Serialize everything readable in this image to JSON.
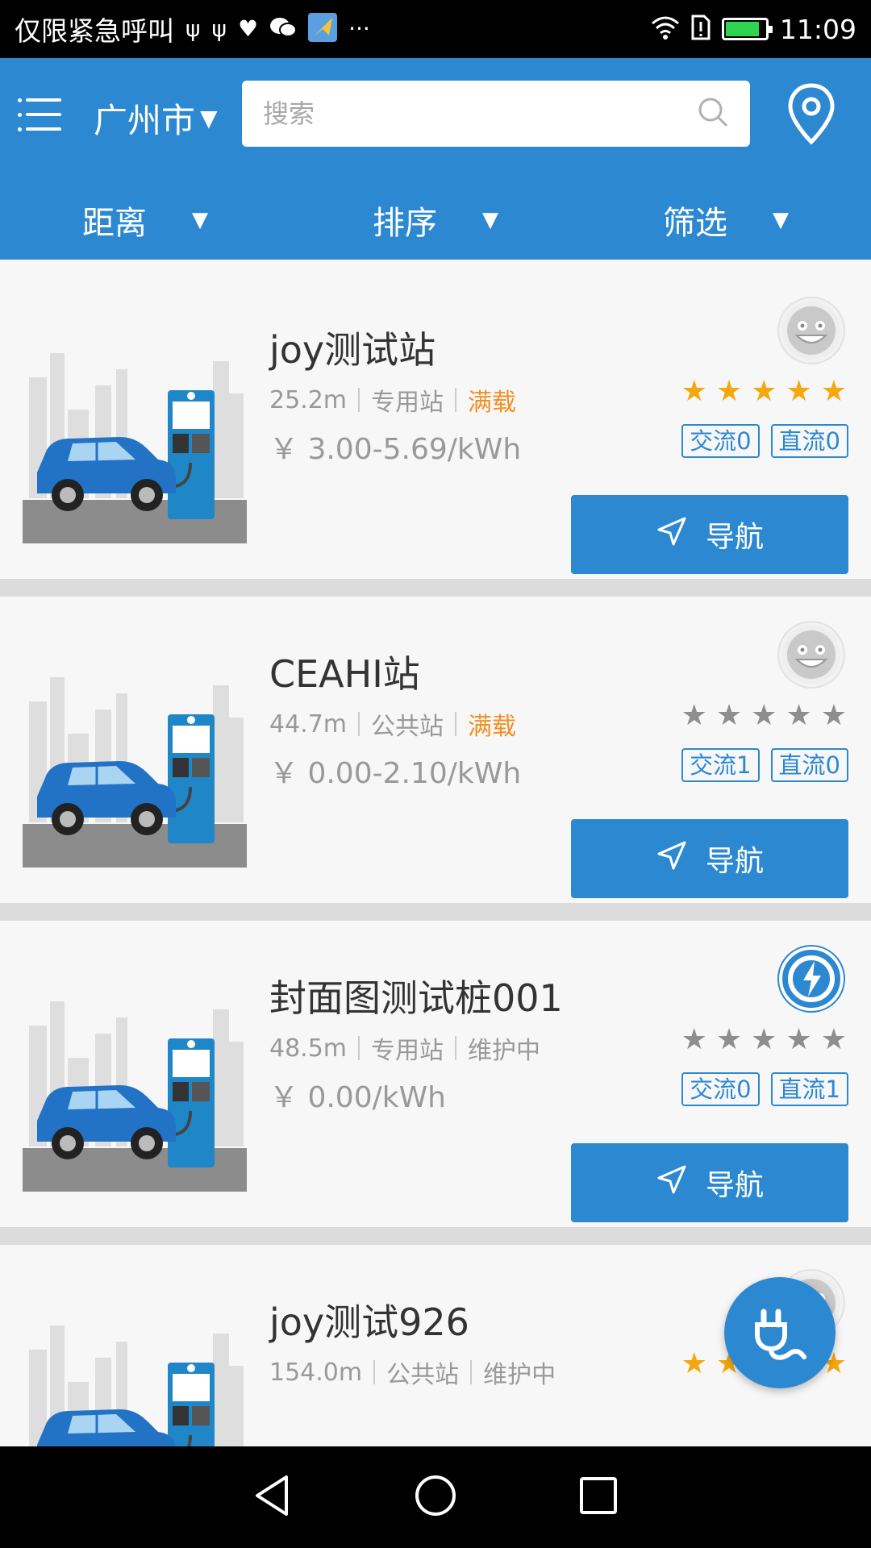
{
  "status_bar": {
    "left_text": "仅限紧急呼叫",
    "more": "···",
    "time": "11:09",
    "battery_level": 0.85,
    "icons": [
      "usb-icon",
      "usb-icon",
      "heartbeat-icon",
      "wechat-icon",
      "maps-icon",
      "telegram-icon",
      "wifi-icon",
      "sim-alert-icon",
      "battery-icon"
    ]
  },
  "header": {
    "city": "广州市",
    "search_placeholder": "搜索",
    "filters": [
      {
        "label": "距离"
      },
      {
        "label": "排序"
      },
      {
        "label": "筛选"
      }
    ],
    "colors": {
      "primary": "#2d88d2",
      "star": "#f5a80d",
      "full_status": "#f39025"
    }
  },
  "stations": [
    {
      "name": "joy测试站",
      "distance": "25.2m",
      "type": "专用站",
      "status": "满载",
      "status_color": "orange",
      "price": "￥ 3.00-5.69/kWh",
      "rating": 5,
      "ac": "交流0",
      "dc": "直流0",
      "logo": "default-face",
      "nav_label": "导航"
    },
    {
      "name": "CEAHI站",
      "distance": "44.7m",
      "type": "公共站",
      "status": "满载",
      "status_color": "orange",
      "price": "￥ 0.00-2.10/kWh",
      "rating": 0,
      "ac": "交流1",
      "dc": "直流0",
      "logo": "default-face",
      "nav_label": "导航"
    },
    {
      "name": "封面图测试桩001",
      "distance": "48.5m",
      "type": "专用站",
      "status": "维护中",
      "status_color": "gray",
      "price": "￥ 0.00/kWh",
      "rating": 0,
      "ac": "交流0",
      "dc": "直流1",
      "logo": "brand",
      "nav_label": "导航"
    },
    {
      "name": "joy测试926",
      "distance": "154.0m",
      "type": "公共站",
      "status": "维护中",
      "status_color": "gray",
      "price": "",
      "rating": 5,
      "ac": "",
      "dc": "",
      "logo": "default-face",
      "nav_label": ""
    }
  ],
  "fab": {
    "icon": "plug-icon"
  },
  "navbar": {
    "icons": [
      "back-icon",
      "home-icon",
      "recents-icon"
    ]
  }
}
